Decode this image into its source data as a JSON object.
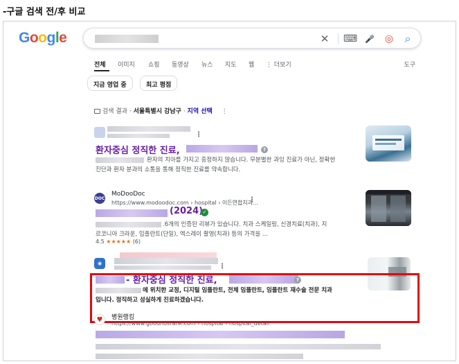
{
  "caption": "-구글 검색 전/후 비교",
  "logo": {
    "g1": "G",
    "o1": "o",
    "o2": "o",
    "g2": "g",
    "l": "l",
    "e": "e"
  },
  "search": {
    "clear_glyph": "✕",
    "keyboard_glyph": "⌨",
    "mic_glyph": "🎤",
    "lens_glyph": "◎",
    "search_glyph": "⌕"
  },
  "tabs": [
    "전체",
    "이미지",
    "쇼핑",
    "동영상",
    "뉴스",
    "지도",
    "웹",
    "⋮ 더보기"
  ],
  "tools": "도구",
  "chips": [
    "지금 영업 중",
    "최고 평점"
  ],
  "location": {
    "prefix": "검색 결과 · ",
    "place": "서울특별시 강남구",
    "sep": " · ",
    "link": "지역 선택",
    "more": "⋮"
  },
  "results": [
    {
      "title": "환자중심 정직한 진료,",
      "snippet1": "환자의 치아를 가지고 흥정하지 않습니다. 무분별한 과잉 진료가 아닌, 정확한",
      "snippet2": "진단과 환자 분과의 소통을 통해 정직한 진료를 약속합니다."
    },
    {
      "site_name": "MoDooDoc",
      "favicon_text": "DOC",
      "site_url": "https://www.modoodoc.com › hospital › 이든연합치과...",
      "title": "(2024)",
      "snippet1": ".6개의 인증된 리뷰가 있습니다. 치과 스케일링, 신경치료(치과), 지",
      "snippet2": "르코니아 크라운, 임플란트(단일), 엑스레이 촬영(치과) 등의 가격을 ...",
      "rating": "4.5",
      "stars": "★★★★★",
      "reviews": "(6)"
    },
    {
      "title": "- 환자중심 정직한 진료,",
      "snippet1": "에 위치한 교정, 디지털 임플란트, 전체 임플란트, 임플란트 재수술 전문 치과",
      "snippet2": "입니다. 정직하고 성실하게 진료하겠습니다."
    },
    {
      "site_name": "병원랭킹",
      "site_url": "https://www.goodhosrank.com › hospital › hospital_detail"
    }
  ],
  "colors": {
    "highlight": "#e3060f",
    "visited_title": "#681da8",
    "link": "#1a0dab"
  }
}
